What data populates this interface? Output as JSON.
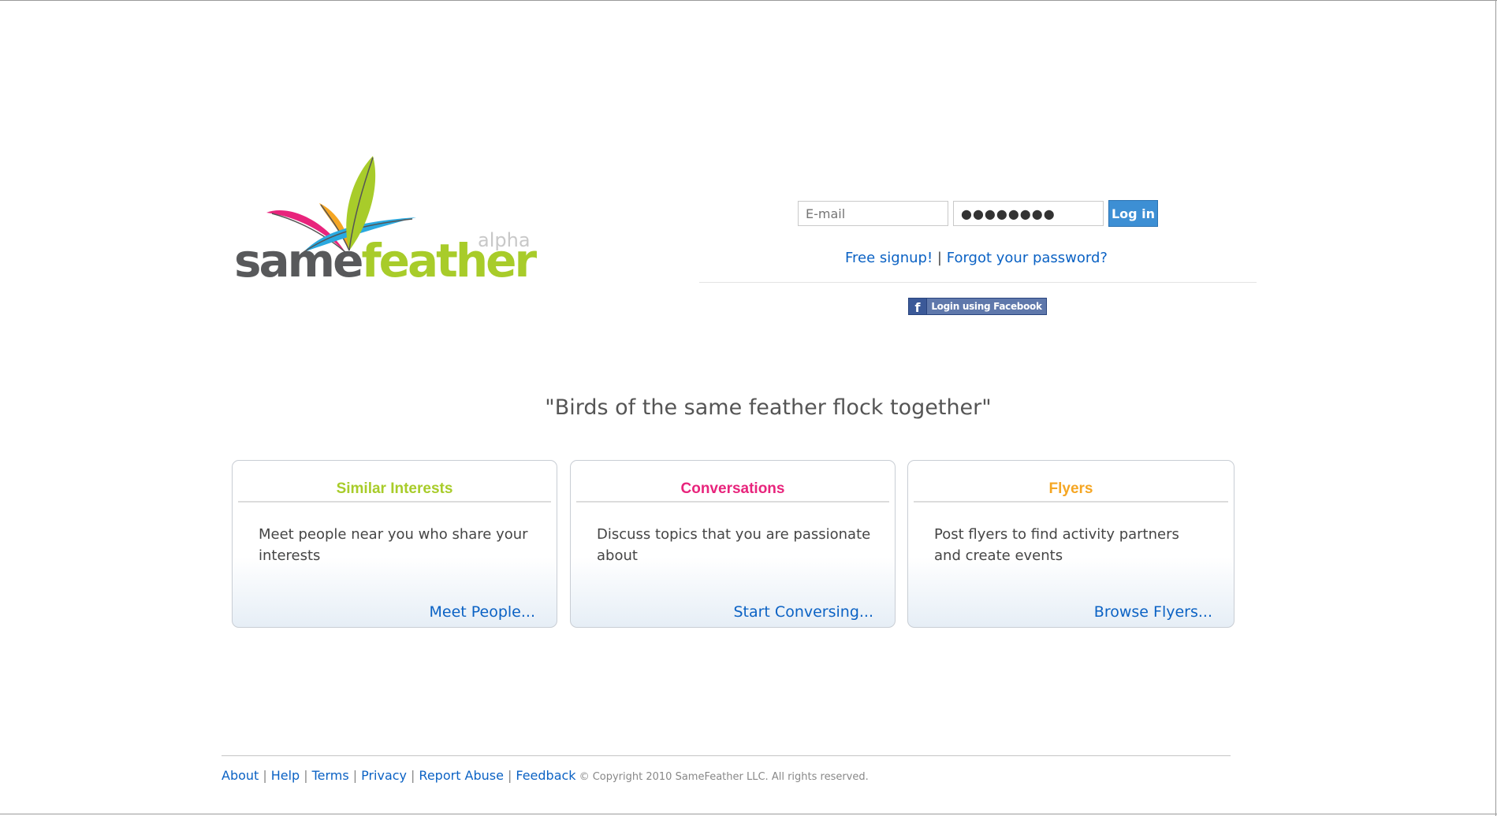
{
  "colors": {
    "link": "#0b62c4",
    "accent_green": "#a8cc2a",
    "accent_pink": "#e8247c",
    "accent_orange": "#f5a623",
    "accent_blue": "#2aa9e0",
    "logo_gray": "#58595b",
    "login_button": "#3d8fd4",
    "facebook": "#3b5998"
  },
  "logo": {
    "word_same": "same",
    "word_feather": "feather",
    "badge": "alpha",
    "icon": "feathers-logo-icon"
  },
  "login": {
    "email_placeholder": "E-mail",
    "email_value": "",
    "password_value": "●●●●●●●●",
    "login_button": "Log in",
    "signup_link": "Free signup!",
    "link_separator": "|",
    "forgot_link": "Forgot your password?",
    "facebook_button": "Login using Facebook",
    "facebook_icon_glyph": "f"
  },
  "tagline": "\"Birds of the same feather flock together\"",
  "cards": [
    {
      "title": "Similar Interests",
      "title_color": "#a8cc2a",
      "description": "Meet people near you who share your interests",
      "link": "Meet People..."
    },
    {
      "title": "Conversations",
      "title_color": "#e8247c",
      "description": "Discuss topics that you are passionate about",
      "link": "Start Conversing..."
    },
    {
      "title": "Flyers",
      "title_color": "#f5a623",
      "description": "Post flyers to find activity partners and create events",
      "link": "Browse Flyers..."
    }
  ],
  "footer": {
    "links": [
      "About",
      "Help",
      "Terms",
      "Privacy",
      "Report Abuse",
      "Feedback"
    ],
    "separator": "|",
    "copyright": "© Copyright 2010 SameFeather LLC. All rights reserved."
  }
}
